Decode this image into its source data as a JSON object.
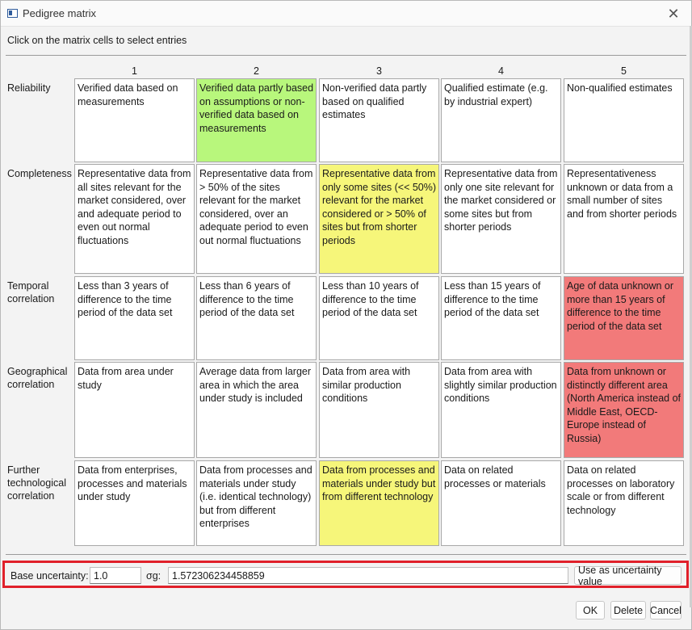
{
  "window": {
    "title": "Pedigree matrix",
    "close_glyph": "✕",
    "app_icon": "app-window-icon",
    "close_icon": "close-icon"
  },
  "instructions": "Click on the matrix cells to select entries",
  "columns": [
    "1",
    "2",
    "3",
    "4",
    "5"
  ],
  "colors": {
    "green": "#b8f77c",
    "yellow": "#f6f67a",
    "red": "#f27a7a",
    "highlight_border": "#e0202a"
  },
  "rows": [
    {
      "label": "Reliability",
      "cells": [
        "Verified data based on measurements",
        "Verified data partly based on assumptions or non-verified data based on measurements",
        "Non-verified data partly based on qualified estimates",
        "Qualified estimate (e.g. by industrial expert)",
        "Non-qualified estimates"
      ]
    },
    {
      "label": "Completeness",
      "cells": [
        "Representative data from all sites relevant for the market considered, over and adequate period to even out normal fluctuations",
        "Representative data from > 50% of the sites relevant for the market considered, over an adequate period to even out normal fluctuations",
        "Representative data from only some sites (<< 50%) relevant for the market considered or > 50% of sites but from shorter periods",
        "Representative data from only one site relevant for the market considered or some sites but from shorter periods",
        "Representativeness unknown or data from a small number of sites and from shorter periods"
      ]
    },
    {
      "label": "Temporal correlation",
      "cells": [
        "Less than 3 years of difference to the time period of the data set",
        "Less than 6 years of difference to the time period of the data set",
        "Less than 10 years of difference to the time period of the data set",
        "Less than 15 years of difference to the time period of the data set",
        "Age of data unknown or more than 15 years of difference to the time period of the data set"
      ]
    },
    {
      "label": "Geographical correlation",
      "cells": [
        "Data from area under study",
        "Average data from larger area in which the area under study is included",
        "Data from area with similar production conditions",
        "Data from area with slightly similar production conditions",
        "Data from unknown or distinctly different area (North America instead of Middle East, OECD-Europe instead of Russia)"
      ]
    },
    {
      "label": "Further technological correlation",
      "cells": [
        "Data from enterprises, processes and materials under study",
        "Data from processes and materials under study (i.e. identical technology) but from different enterprises",
        "Data from processes and materials under study but from different technology",
        "Data on related processes or materials",
        "Data on related processes on laboratory scale or from different technology"
      ]
    }
  ],
  "selected": [
    {
      "row": 0,
      "col": 1,
      "color": "green"
    },
    {
      "row": 1,
      "col": 2,
      "color": "yellow"
    },
    {
      "row": 2,
      "col": 4,
      "color": "red"
    },
    {
      "row": 3,
      "col": 4,
      "color": "red"
    },
    {
      "row": 4,
      "col": 2,
      "color": "yellow"
    }
  ],
  "bottom": {
    "base_uncertainty_label": "Base uncertainty:",
    "base_uncertainty_value": "1.0",
    "sigma_label": "σg:",
    "sigma_value": "1.572306234458859",
    "use_button": "Use as uncertainty value"
  },
  "buttons": {
    "ok": "OK",
    "delete": "Delete",
    "cancel": "Cancel"
  }
}
